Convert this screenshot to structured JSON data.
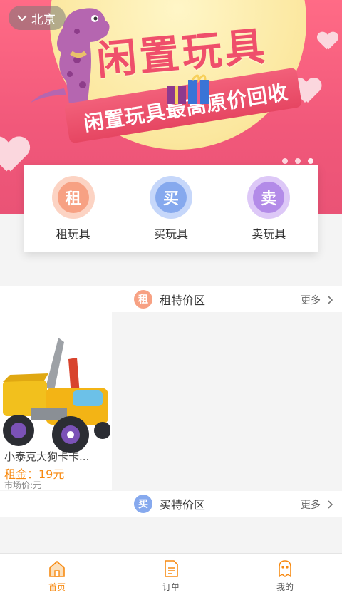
{
  "city": {
    "name": "北京"
  },
  "banner": {
    "headline": "闲置玩具",
    "subline": "闲置玩具最高原价回收",
    "dots": 3,
    "active_dot": 2
  },
  "categories": [
    {
      "glyph": "租",
      "label": "租玩具",
      "color": "#f7a183",
      "ring": "#fcd3c3"
    },
    {
      "glyph": "买",
      "label": "买玩具",
      "color": "#86a9ee",
      "ring": "#c6d7fa"
    },
    {
      "glyph": "卖",
      "label": "卖玩具",
      "color": "#b38be8",
      "ring": "#ddc8f7"
    }
  ],
  "sections": {
    "rent": {
      "badge": "租",
      "title": "租特价区",
      "more": "更多",
      "color": "#f7a183"
    },
    "buy": {
      "badge": "买",
      "title": "买特价区",
      "more": "更多",
      "color": "#86a9ee"
    }
  },
  "product": {
    "name": "小泰克大狗卡卡...",
    "price": "租金：19元",
    "market": "市场价:元"
  },
  "tabs": [
    {
      "label": "首页",
      "icon": "home-icon",
      "active": true
    },
    {
      "label": "订单",
      "icon": "order-icon",
      "active": false
    },
    {
      "label": "我的",
      "icon": "profile-icon",
      "active": false
    }
  ],
  "colors": {
    "accent": "#f78a12",
    "banner": "#f1587a"
  }
}
